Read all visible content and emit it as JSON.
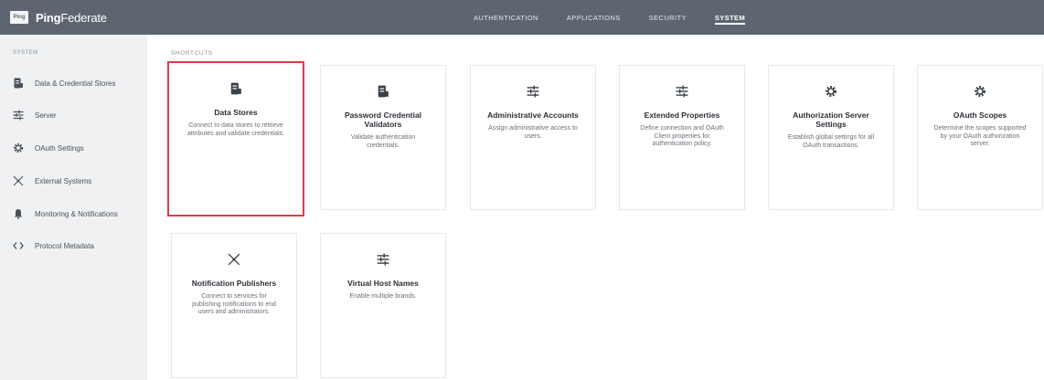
{
  "brand": {
    "logo_text": "Ping",
    "name_bold": "Ping",
    "name_light": "Federate"
  },
  "topnav": [
    {
      "label": "AUTHENTICATION",
      "active": false
    },
    {
      "label": "APPLICATIONS",
      "active": false
    },
    {
      "label": "SECURITY",
      "active": false
    },
    {
      "label": "SYSTEM",
      "active": true
    }
  ],
  "sidebar": {
    "header": "SYSTEM",
    "items": [
      {
        "label": "Data & Credential Stores",
        "icon": "database-icon"
      },
      {
        "label": "Server",
        "icon": "sliders-icon"
      },
      {
        "label": "OAuth Settings",
        "icon": "gear-icon"
      },
      {
        "label": "External Systems",
        "icon": "network-icon"
      },
      {
        "label": "Monitoring & Notifications",
        "icon": "bell-icon"
      },
      {
        "label": "Protocol Metadata",
        "icon": "code-icon"
      }
    ]
  },
  "main": {
    "shortcuts_label": "SHORTCUTS",
    "cards": [
      {
        "title": "Data Stores",
        "desc": "Connect to data stores to retrieve attributes and validate credentials.",
        "icon": "database-icon"
      },
      {
        "title": "Password Credential Validators",
        "desc": "Validate authentication credentials.",
        "icon": "database-icon"
      },
      {
        "title": "Administrative Accounts",
        "desc": "Assign administrative access to users.",
        "icon": "sliders-icon"
      },
      {
        "title": "Extended Properties",
        "desc": "Define connection and OAuth Client properties for authentication policy.",
        "icon": "sliders-icon"
      },
      {
        "title": "Authorization Server Settings",
        "desc": "Establish global settings for all OAuth transactions.",
        "icon": "gear-icon"
      },
      {
        "title": "OAuth Scopes",
        "desc": "Determine the scopes supported by your OAuth authorization server.",
        "icon": "gear-icon"
      },
      {
        "title": "Notification Publishers",
        "desc": "Connect to services for publishing notifications to end users and administrators.",
        "icon": "network-icon"
      },
      {
        "title": "Virtual Host Names",
        "desc": "Enable multiple brands.",
        "icon": "sliders-icon"
      }
    ]
  },
  "colors": {
    "topbar": "#5d6670",
    "sidebar": "#f0f1f2",
    "selected_border": "#e53945"
  }
}
